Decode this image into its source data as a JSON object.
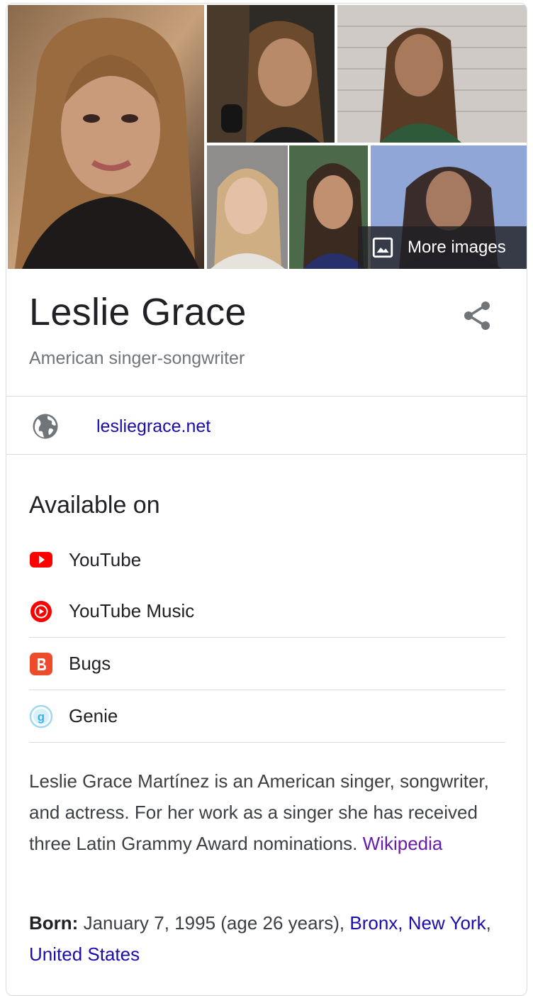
{
  "gallery": {
    "more_images_label": "More images"
  },
  "entity": {
    "title": "Leslie Grace",
    "subtitle": "American singer-songwriter"
  },
  "website": {
    "label": "lesliegrace.net",
    "icon": "globe-icon"
  },
  "available_on": {
    "heading": "Available on",
    "platforms": [
      {
        "label": "YouTube",
        "icon": "youtube-icon",
        "color": "#ff0000"
      },
      {
        "label": "YouTube Music",
        "icon": "youtube-music-icon",
        "color": "#ff0000"
      },
      {
        "label": "Bugs",
        "icon": "bugs-icon",
        "color": "#ee4b2b"
      },
      {
        "label": "Genie",
        "icon": "genie-icon",
        "color": "#3cb4e5"
      }
    ]
  },
  "description": {
    "text": "Leslie Grace Martínez is an American singer, songwriter, and actress. For her work as a singer she has received three Latin Grammy Award nominations.",
    "source_label": "Wikipedia"
  },
  "born": {
    "label": "Born:",
    "value": "January 7, 1995 (age 26 years),",
    "place_1": "Bronx, New York",
    "separator": ",",
    "place_2": "United States"
  },
  "colors": {
    "link": "#1a0dab",
    "visited_link": "#681da8",
    "subtitle_gray": "#70757a",
    "divider": "#dadce0"
  }
}
